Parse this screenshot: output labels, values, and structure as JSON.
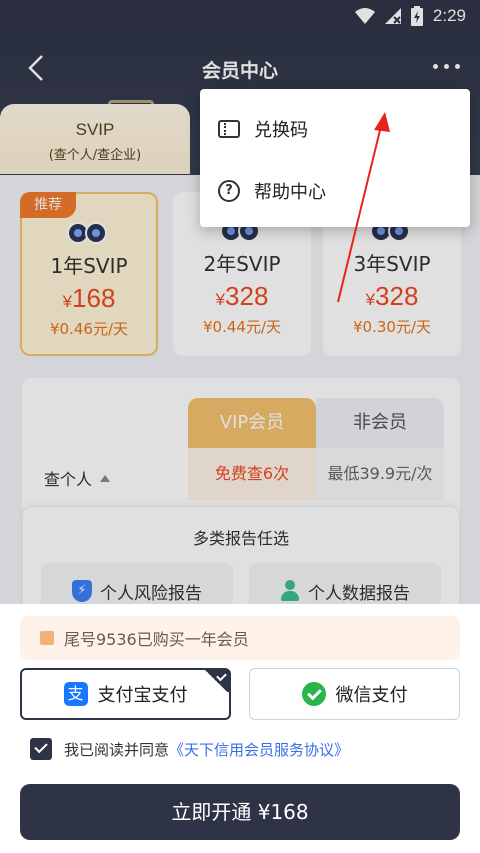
{
  "status_bar": {
    "time": "2:29"
  },
  "header": {
    "title": "会员中心"
  },
  "tabs": [
    {
      "label": "SVIP",
      "sublabel": "(查个人/查企业)"
    }
  ],
  "plans": [
    {
      "badge": "推荐",
      "name": "1年SVIP",
      "currency": "¥",
      "price": "168",
      "daily": "¥0.46元/天"
    },
    {
      "name": "2年SVIP",
      "currency": "¥",
      "price": "328",
      "daily": "¥0.44元/天"
    },
    {
      "name": "3年SVIP",
      "currency": "¥",
      "price": "328",
      "daily": "¥0.30元/天"
    }
  ],
  "compare": {
    "col_vip": "VIP会员",
    "col_non": "非会员",
    "row_label": "查个人",
    "cell_vip": "免费查6次",
    "cell_non": "最低39.9元/次",
    "panel_title": "多类报告任选",
    "report_1": "个人风险报告",
    "report_2": "个人数据报告"
  },
  "notice": "尾号9536已购买一年会员",
  "payment": {
    "alipay": "支付宝支付",
    "wechat": "微信支付"
  },
  "agreement": {
    "text": "我已阅读并同意",
    "link": "《天下信用会员服务协议》"
  },
  "cta": "立即开通 ¥168",
  "menu": [
    {
      "label": "兑换码"
    },
    {
      "label": "帮助中心"
    }
  ],
  "colors": {
    "dark": "#2e3446",
    "accent": "#f04a23",
    "gold": "#f5c270"
  }
}
